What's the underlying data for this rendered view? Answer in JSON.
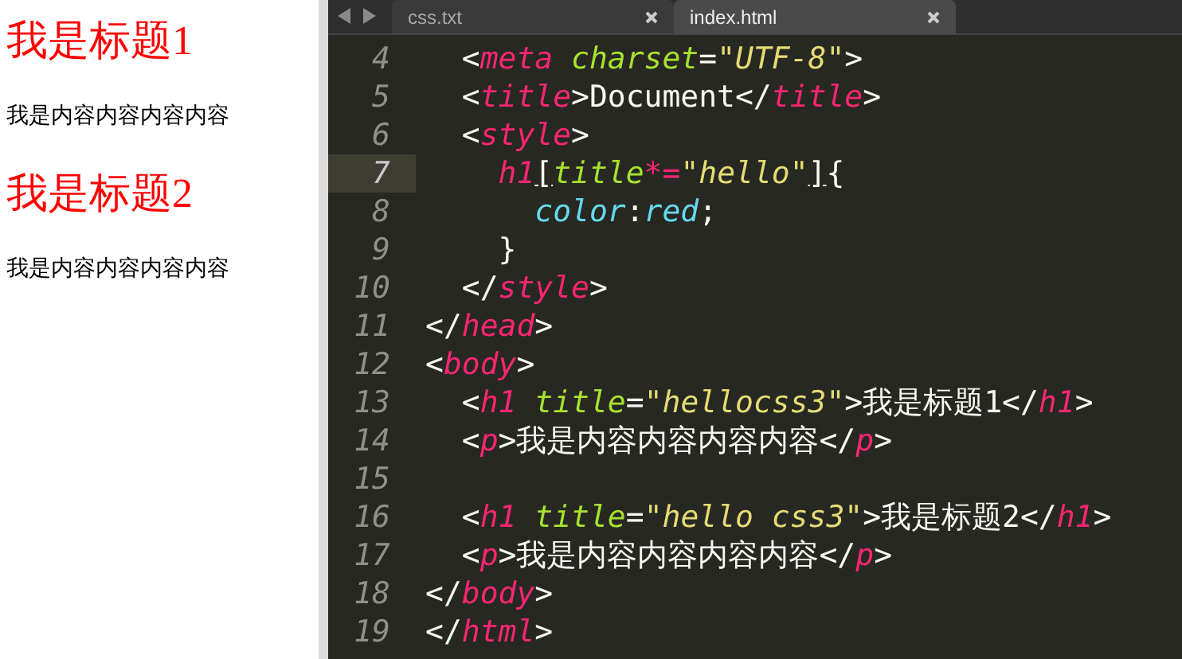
{
  "preview": {
    "blocks": [
      {
        "kind": "heading",
        "text": "我是标题1"
      },
      {
        "kind": "paragraph",
        "text": "我是内容内容内容内容"
      },
      {
        "kind": "heading",
        "text": "我是标题2"
      },
      {
        "kind": "paragraph",
        "text": "我是内容内容内容内容"
      }
    ]
  },
  "tabs": [
    {
      "label": "css.txt",
      "selected": false
    },
    {
      "label": "index.html",
      "selected": true
    }
  ],
  "editor": {
    "lines": [
      {
        "number": "4",
        "selected": false,
        "tokens": [
          {
            "kind": "punct",
            "text": "  <"
          },
          {
            "kind": "tag",
            "text": "meta "
          },
          {
            "kind": "attr",
            "text": "charset"
          },
          {
            "kind": "punct",
            "text": "="
          },
          {
            "kind": "string",
            "text": "\"UTF-8\""
          },
          {
            "kind": "punct",
            "text": ">"
          }
        ]
      },
      {
        "number": "5",
        "selected": false,
        "tokens": [
          {
            "kind": "punct",
            "text": "  <"
          },
          {
            "kind": "tag",
            "text": "title"
          },
          {
            "kind": "punct",
            "text": ">Document</"
          },
          {
            "kind": "tag",
            "text": "title"
          },
          {
            "kind": "punct",
            "text": ">"
          }
        ]
      },
      {
        "number": "6",
        "selected": false,
        "tokens": [
          {
            "kind": "punct",
            "text": "  <"
          },
          {
            "kind": "tag",
            "text": "style"
          },
          {
            "kind": "punct",
            "text": ">"
          }
        ]
      },
      {
        "number": "7",
        "selected": true,
        "tokens": [
          {
            "kind": "tag",
            "text": "    h1"
          },
          {
            "kind": "bracket",
            "text": "["
          },
          {
            "kind": "attr",
            "text": "title"
          },
          {
            "kind": "tag",
            "text": "*="
          },
          {
            "kind": "string",
            "text": "\"hello\""
          },
          {
            "kind": "bracket",
            "text": "]"
          },
          {
            "kind": "punct",
            "text": "{"
          }
        ]
      },
      {
        "number": "8",
        "selected": false,
        "tokens": [
          {
            "kind": "prop",
            "text": "      color"
          },
          {
            "kind": "punct",
            "text": ":"
          },
          {
            "kind": "prop",
            "text": "red"
          },
          {
            "kind": "punct",
            "text": ";"
          }
        ]
      },
      {
        "number": "9",
        "selected": false,
        "tokens": [
          {
            "kind": "punct",
            "text": "    }"
          }
        ]
      },
      {
        "number": "10",
        "selected": false,
        "tokens": [
          {
            "kind": "punct",
            "text": "  </"
          },
          {
            "kind": "tag",
            "text": "style"
          },
          {
            "kind": "punct",
            "text": ">"
          }
        ]
      },
      {
        "number": "11",
        "selected": false,
        "tokens": [
          {
            "kind": "punct",
            "text": "</"
          },
          {
            "kind": "tag",
            "text": "head"
          },
          {
            "kind": "punct",
            "text": ">"
          }
        ]
      },
      {
        "number": "12",
        "selected": false,
        "tokens": [
          {
            "kind": "punct",
            "text": "<"
          },
          {
            "kind": "tag",
            "text": "body"
          },
          {
            "kind": "punct",
            "text": ">"
          }
        ]
      },
      {
        "number": "13",
        "selected": false,
        "tokens": [
          {
            "kind": "punct",
            "text": "  <"
          },
          {
            "kind": "tag",
            "text": "h1 "
          },
          {
            "kind": "attr",
            "text": "title"
          },
          {
            "kind": "punct",
            "text": "="
          },
          {
            "kind": "string",
            "text": "\"hellocss3\""
          },
          {
            "kind": "punct",
            "text": ">我是标题1</"
          },
          {
            "kind": "tag",
            "text": "h1"
          },
          {
            "kind": "punct",
            "text": ">"
          }
        ]
      },
      {
        "number": "14",
        "selected": false,
        "tokens": [
          {
            "kind": "punct",
            "text": "  <"
          },
          {
            "kind": "tag",
            "text": "p"
          },
          {
            "kind": "punct",
            "text": ">我是内容内容内容内容</"
          },
          {
            "kind": "tag",
            "text": "p"
          },
          {
            "kind": "punct",
            "text": ">"
          }
        ]
      },
      {
        "number": "15",
        "selected": false
      },
      {
        "number": "16",
        "selected": false,
        "tokens": [
          {
            "kind": "punct",
            "text": "  <"
          },
          {
            "kind": "tag",
            "text": "h1 "
          },
          {
            "kind": "attr",
            "text": "title"
          },
          {
            "kind": "punct",
            "text": "="
          },
          {
            "kind": "string",
            "text": "\"hello css3\""
          },
          {
            "kind": "punct",
            "text": ">我是标题2</"
          },
          {
            "kind": "tag",
            "text": "h1"
          },
          {
            "kind": "punct",
            "text": ">"
          }
        ]
      },
      {
        "number": "17",
        "selected": false,
        "tokens": [
          {
            "kind": "punct",
            "text": "  <"
          },
          {
            "kind": "tag",
            "text": "p"
          },
          {
            "kind": "punct",
            "text": ">我是内容内容内容内容</"
          },
          {
            "kind": "tag",
            "text": "p"
          },
          {
            "kind": "punct",
            "text": ">"
          }
        ]
      },
      {
        "number": "18",
        "selected": false,
        "tokens": [
          {
            "kind": "punct",
            "text": "</"
          },
          {
            "kind": "tag",
            "text": "body"
          },
          {
            "kind": "punct",
            "text": ">"
          }
        ]
      },
      {
        "number": "19",
        "selected": false,
        "tokens": [
          {
            "kind": "punct",
            "text": "</"
          },
          {
            "kind": "tag",
            "text": "html"
          },
          {
            "kind": "punct",
            "text": ">"
          }
        ]
      }
    ]
  }
}
